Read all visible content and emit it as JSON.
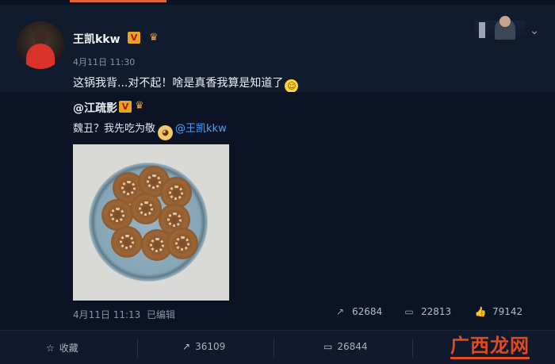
{
  "post": {
    "author": "王凯kkw",
    "verified_badge": "V",
    "time": "4月11日 11:30",
    "text": "这锅我背...对不起！啥是真香我算是知道了"
  },
  "quoted": {
    "author": "@江疏影",
    "verified_badge": "V",
    "text_before": "魏丑？我先吃为敬",
    "mention": "@王凯kkw",
    "time": "4月11日 11:13",
    "edited": "已编辑",
    "stats": {
      "forward": "62684",
      "comment": "22813",
      "like": "79142"
    }
  },
  "footer": {
    "collect": "收藏",
    "forward": "36109",
    "comment": "26844"
  },
  "watermark": "广西龙网",
  "icons": {
    "verified": "v-badge-icon",
    "crown": "crown-icon",
    "expand": "chevron-down-icon",
    "forward": "forward-icon",
    "comment": "comment-icon",
    "like": "like-icon",
    "collect": "star-icon"
  },
  "colors": {
    "accent": "#e0663a",
    "mention": "#4aa3ff",
    "watermark": "#e04a1f"
  }
}
